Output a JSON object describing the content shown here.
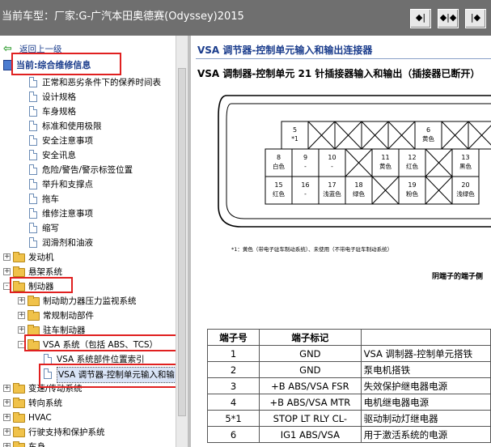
{
  "header": {
    "car_title": "当前车型：厂家:G-广汽本田奥德赛(Odyssey)2015",
    "buttons": [
      {
        "name": "collapse-left-button",
        "glyph": "◆|"
      },
      {
        "name": "split-view-button",
        "glyph": "◆|◆"
      },
      {
        "name": "collapse-right-button",
        "glyph": "|◆"
      }
    ]
  },
  "tree": {
    "back_label": "返回上一级",
    "current_label": "当前:综合维修信息",
    "items": [
      {
        "type": "doc",
        "label": "正常和恶劣条件下的保养时间表",
        "level": 1
      },
      {
        "type": "doc",
        "label": "设计规格",
        "level": 1
      },
      {
        "type": "doc",
        "label": "车身规格",
        "level": 1
      },
      {
        "type": "doc",
        "label": "标准和使用极限",
        "level": 1
      },
      {
        "type": "doc",
        "label": "安全注意事项",
        "level": 1
      },
      {
        "type": "doc",
        "label": "安全讯息",
        "level": 1
      },
      {
        "type": "doc",
        "label": "危险/警告/警示标签位置",
        "level": 1
      },
      {
        "type": "doc",
        "label": "举升和支撑点",
        "level": 1
      },
      {
        "type": "doc",
        "label": "拖车",
        "level": 1
      },
      {
        "type": "doc",
        "label": "维修注意事项",
        "level": 1
      },
      {
        "type": "doc",
        "label": "缩写",
        "level": 1
      },
      {
        "type": "doc",
        "label": "润滑剂和油液",
        "level": 1
      },
      {
        "type": "folder",
        "label": "发动机",
        "level": 0,
        "exp": "+"
      },
      {
        "type": "folder",
        "label": "悬架系统",
        "level": 0,
        "exp": "+"
      },
      {
        "type": "folder",
        "label": "制动器",
        "level": 0,
        "exp": "-"
      },
      {
        "type": "folder",
        "label": "制动助力器压力监视系统",
        "level": 1,
        "exp": "+"
      },
      {
        "type": "folder",
        "label": "常规制动部件",
        "level": 1,
        "exp": "+"
      },
      {
        "type": "folder",
        "label": "驻车制动器",
        "level": 1,
        "exp": "+"
      },
      {
        "type": "folder",
        "label": "VSA 系统（包括 ABS、TCS）",
        "level": 1,
        "exp": "-"
      },
      {
        "type": "doc",
        "label": "VSA 系统部件位置索引",
        "level": 2
      },
      {
        "type": "doc",
        "label": "VSA 调节器-控制单元输入和输出连接器",
        "level": 2,
        "selected": true
      },
      {
        "type": "folder",
        "label": "变速/传动系统",
        "level": 0,
        "exp": "+"
      },
      {
        "type": "folder",
        "label": "转向系统",
        "level": 0,
        "exp": "+"
      },
      {
        "type": "folder",
        "label": "HVAC",
        "level": 0,
        "exp": "+"
      },
      {
        "type": "folder",
        "label": "行驶支持和保护系统",
        "level": 0,
        "exp": "+"
      },
      {
        "type": "folder",
        "label": "车身",
        "level": 0,
        "exp": "+"
      }
    ]
  },
  "content": {
    "section_title": "VSA 调节器-控制单元输入和输出连接器",
    "figure_title": "VSA 调制器-控制单元  21 针插接器输入和输出（插接器已断开）",
    "connector_pins_top": [
      {
        "num": "5",
        "note": "*1",
        "color": ""
      },
      {
        "num": "6",
        "note": "",
        "color": "黄色"
      }
    ],
    "connector_pins_mid": [
      {
        "num": "8",
        "color": "白色"
      },
      {
        "num": "9",
        "color": "-"
      },
      {
        "num": "10",
        "color": "-"
      },
      {
        "num": "11",
        "color": "黄色"
      },
      {
        "num": "12",
        "color": "红色"
      },
      {
        "num": "13",
        "color": "黑色"
      }
    ],
    "connector_pins_bot": [
      {
        "num": "15",
        "color": "红色"
      },
      {
        "num": "16",
        "color": "-"
      },
      {
        "num": "17",
        "color": "浅蓝色"
      },
      {
        "num": "18",
        "color": "绿色"
      },
      {
        "num": "19",
        "color": "粉色"
      },
      {
        "num": "20",
        "color": "浅绿色"
      }
    ],
    "footnote": "*1：黄色（带电子驻车制动系统）、未使用（不带电子驻车制动系统）",
    "side_note": "阴端子的端子侧",
    "table": {
      "headers": [
        "端子号",
        "端子标记",
        ""
      ],
      "rows": [
        {
          "pin": "1",
          "mark": "GND",
          "desc": "VSA 调制器-控制单元搭铁"
        },
        {
          "pin": "2",
          "mark": "GND",
          "desc": "泵电机搭铁"
        },
        {
          "pin": "3",
          "mark": "+B ABS/VSA FSR",
          "desc": "失效保护继电器电源"
        },
        {
          "pin": "4",
          "mark": "+B ABS/VSA MTR",
          "desc": "电机继电器电源"
        },
        {
          "pin": "5*1",
          "mark": "STOP LT RLY CL-",
          "desc": "驱动制动灯继电器"
        },
        {
          "pin": "6",
          "mark": "IG1 ABS/VSA",
          "desc": "用于激活系统的电源"
        }
      ]
    }
  }
}
